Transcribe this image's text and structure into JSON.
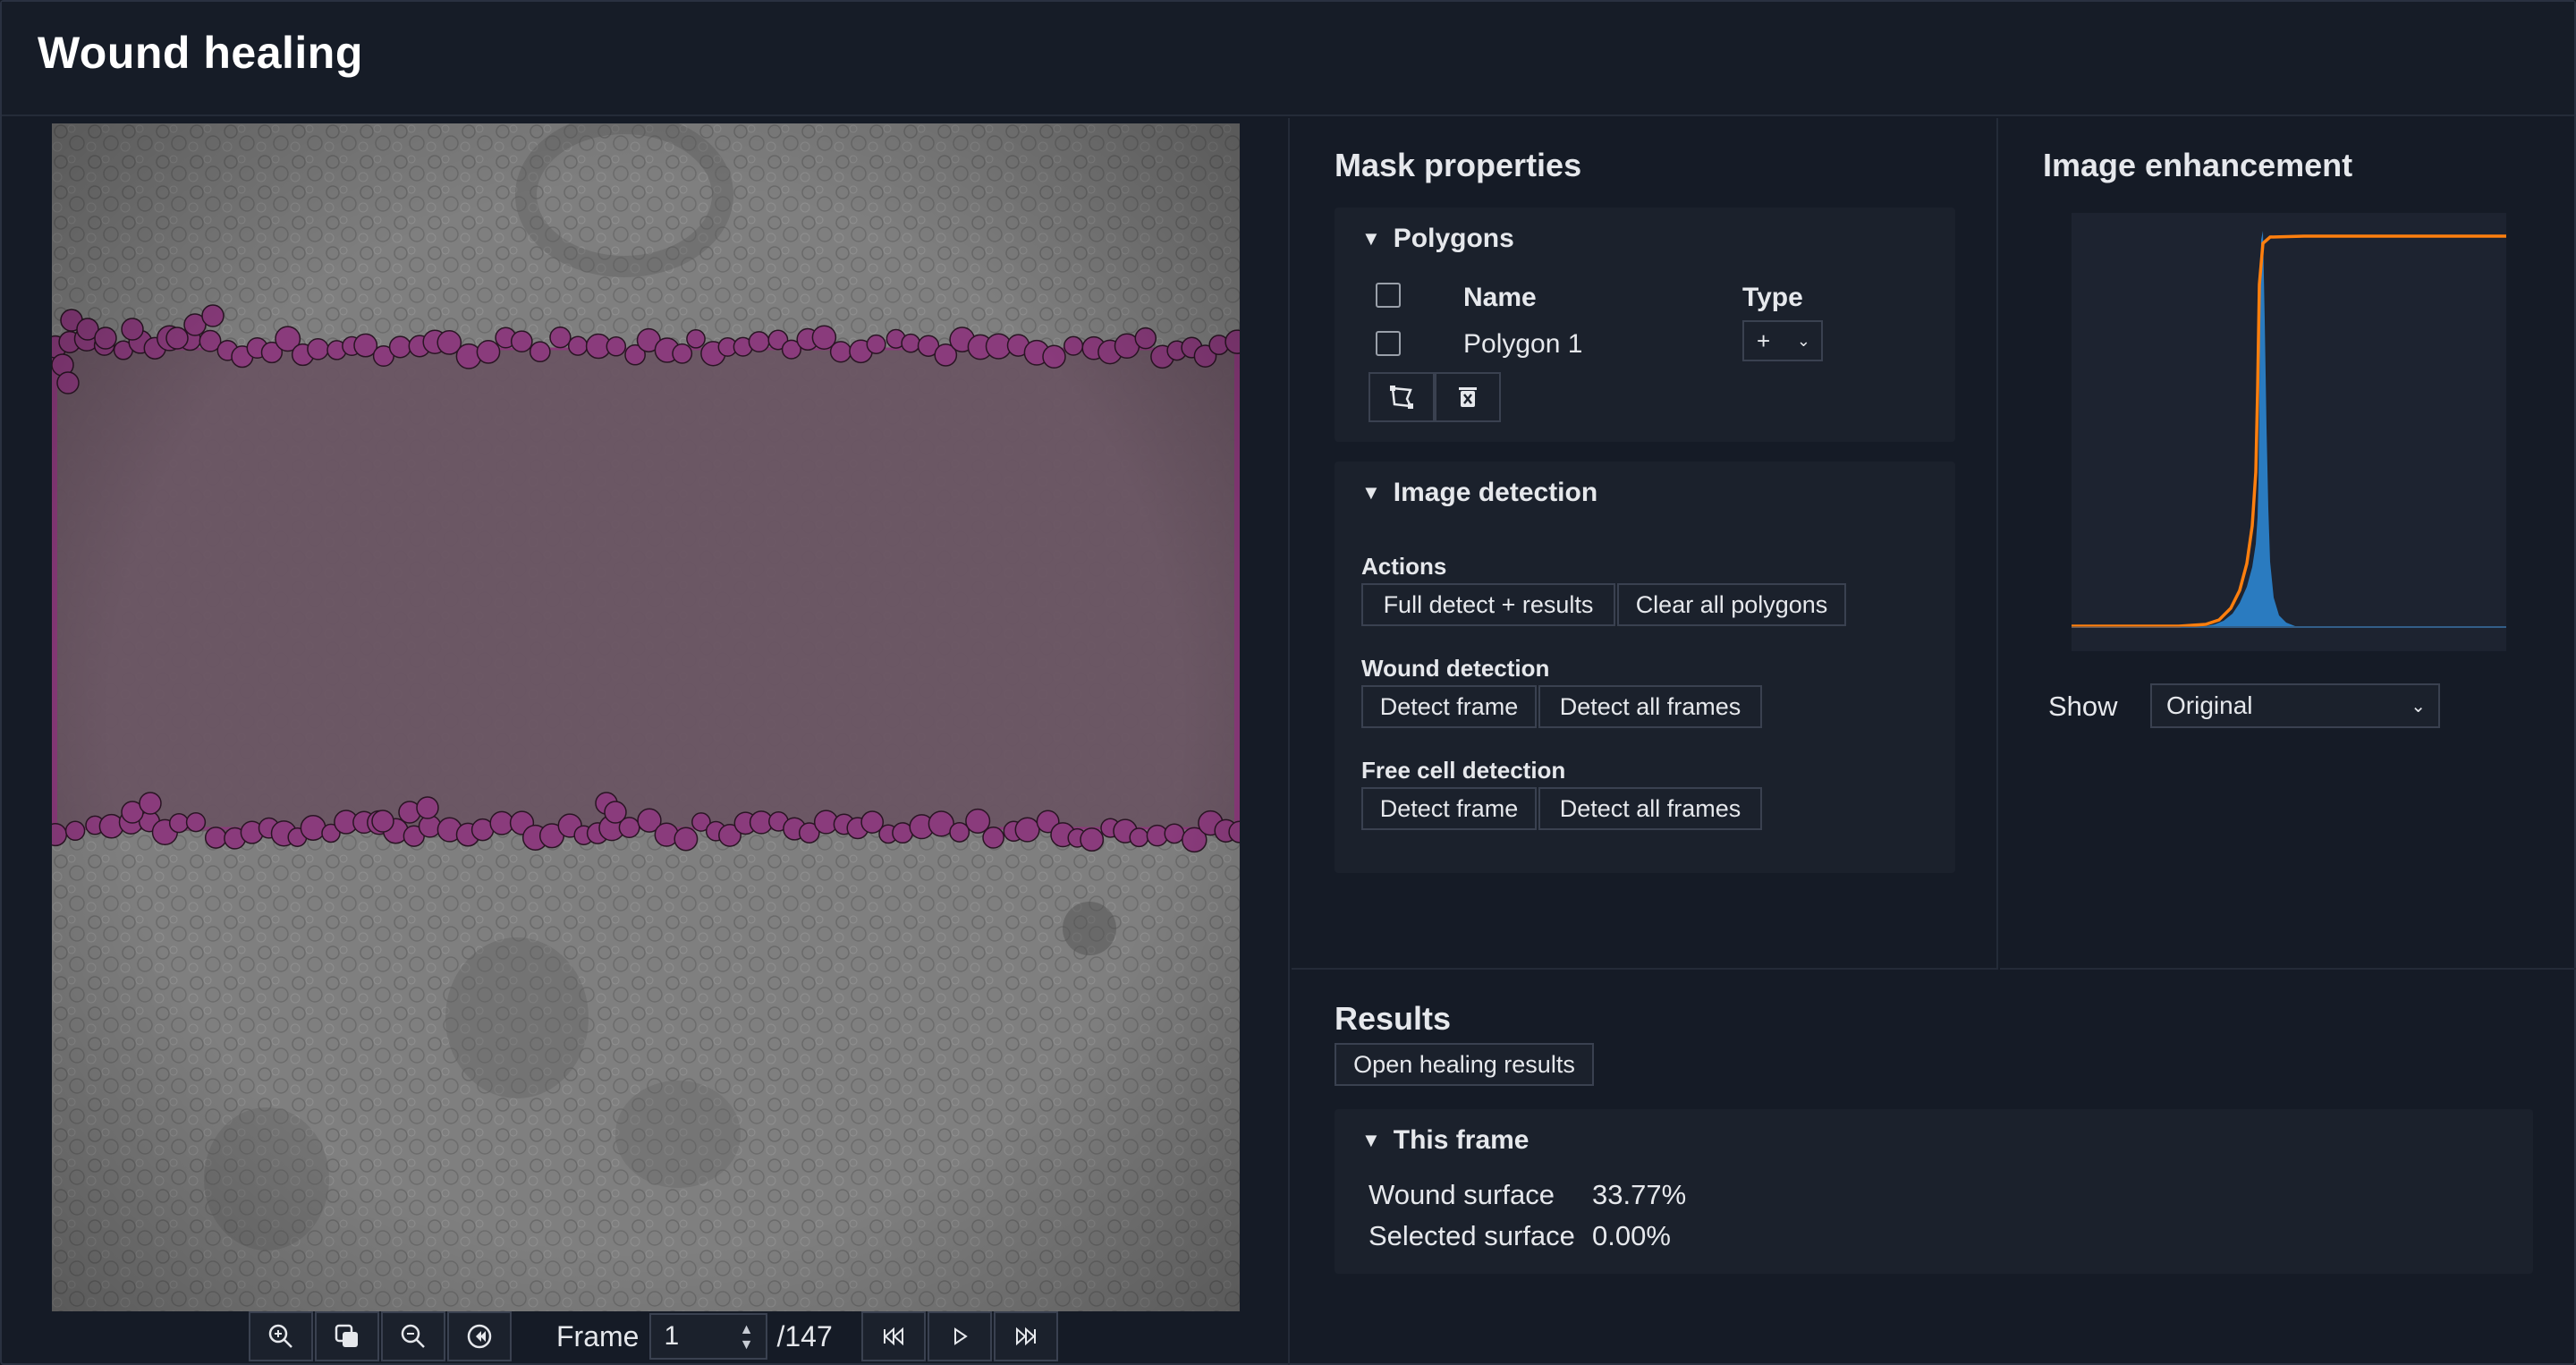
{
  "app": {
    "title": "Wound healing"
  },
  "viewer": {
    "frame_label": "Frame",
    "frame_value": "1",
    "frame_total": "/147",
    "toolbar": [
      "zoom-in-icon",
      "fit-icon",
      "zoom-out-icon",
      "reset-icon"
    ],
    "playback": [
      "skip-back-icon",
      "play-icon",
      "skip-forward-icon"
    ]
  },
  "mask_panel": {
    "title": "Mask properties",
    "polygons": {
      "heading": "Polygons",
      "col_name": "Name",
      "col_type": "Type",
      "rows": [
        {
          "name": "Polygon 1",
          "type": "+"
        }
      ]
    },
    "image_detection": {
      "heading": "Image detection",
      "actions_label": "Actions",
      "full_detect": "Full detect + results",
      "clear_all": "Clear all polygons",
      "wound_label": "Wound detection",
      "wound_detect_frame": "Detect frame",
      "wound_detect_all": "Detect all frames",
      "free_label": "Free cell detection",
      "free_detect_frame": "Detect frame",
      "free_detect_all": "Detect all frames"
    }
  },
  "enhancement": {
    "title": "Image enhancement",
    "show_label": "Show",
    "show_value": "Original",
    "colors": {
      "histogram": "#1f77b4",
      "curve": "#ff7f0e"
    }
  },
  "results": {
    "title": "Results",
    "open_button": "Open healing results",
    "this_frame": {
      "heading": "This frame",
      "wound_label": "Wound surface",
      "wound_value": "33.77%",
      "selected_label": "Selected surface",
      "selected_value": "0.00%"
    }
  },
  "colors": {
    "mask": "#7a3a6a",
    "accent": "#ff7f0e"
  }
}
